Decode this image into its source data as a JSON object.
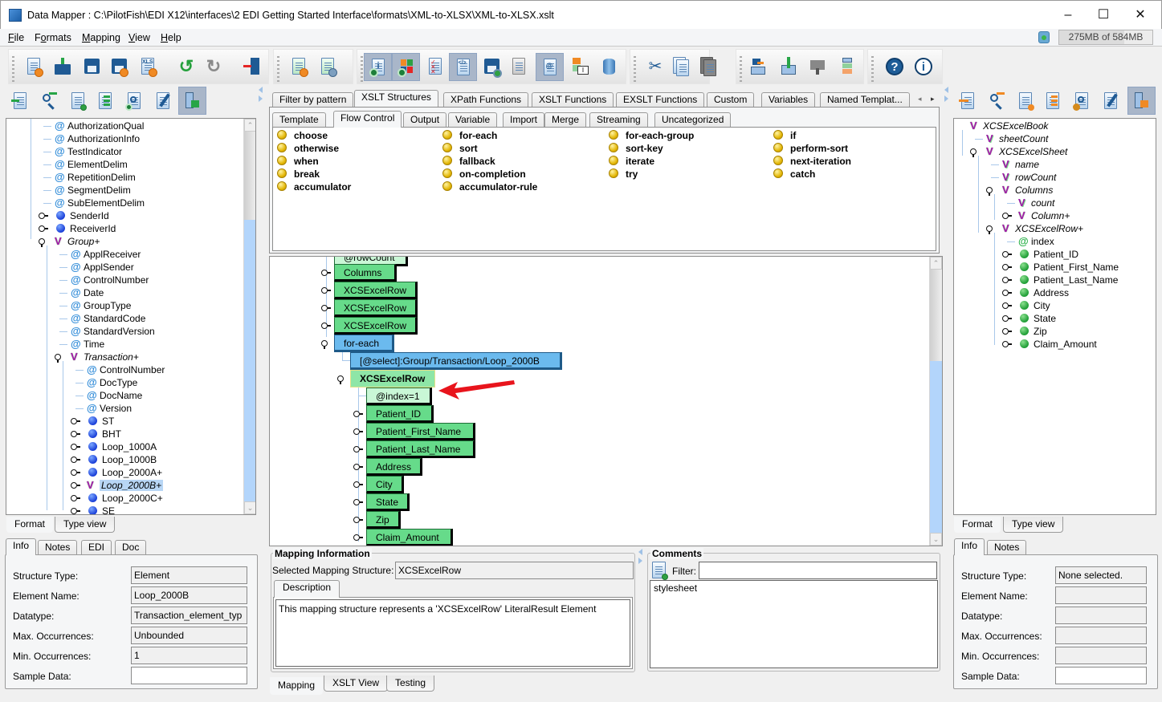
{
  "window": {
    "title": "Data Mapper : C:\\PilotFish\\EDI X12\\interfaces\\2 EDI Getting Started Interface\\formats\\XML-to-XLSX\\XML-to-XLSX.xslt",
    "minimize": "–",
    "maximize": "☐",
    "close": "✕"
  },
  "menu": [
    {
      "label": "File",
      "mnemonic": "F"
    },
    {
      "label": "Formats",
      "mnemonic": "o"
    },
    {
      "label": "Mapping",
      "mnemonic": "M"
    },
    {
      "label": "View",
      "mnemonic": "V"
    },
    {
      "label": "Help",
      "mnemonic": "H"
    }
  ],
  "memory": {
    "used": "275MB",
    "total": "584MB",
    "label": "275MB of 584MB",
    "fraction_used": 0.47
  },
  "main_toolbar": {
    "groups": [
      [
        "new-format",
        "open",
        "save",
        "save-as",
        "export-xls",
        "undo",
        "redo",
        "exit"
      ],
      [
        "new-mapping",
        "mapping-settings"
      ],
      [
        "show-info",
        "show-colors",
        "validate",
        "xslt-source",
        "save-schedule",
        "wsdl",
        "namespaces",
        "rename",
        "database"
      ],
      [
        "cut",
        "copy",
        "paste"
      ],
      [
        "move-up-level",
        "move-up",
        "move-down",
        "reorder"
      ],
      [
        "help",
        "about"
      ]
    ]
  },
  "source": {
    "toolbar": [
      "import",
      "find",
      "notes",
      "structure",
      "preview",
      "edit",
      "select-mode"
    ],
    "tree": [
      {
        "label": "AuthorizationQual",
        "type": "attribute",
        "depth": 1
      },
      {
        "label": "AuthorizationInfo",
        "type": "attribute",
        "depth": 1
      },
      {
        "label": "TestIndicator",
        "type": "attribute",
        "depth": 1
      },
      {
        "label": "ElementDelim",
        "type": "attribute",
        "depth": 1
      },
      {
        "label": "RepetitionDelim",
        "type": "attribute",
        "depth": 1
      },
      {
        "label": "SegmentDelim",
        "type": "attribute",
        "depth": 1
      },
      {
        "label": "SubElementDelim",
        "type": "attribute",
        "depth": 1
      },
      {
        "label": "SenderId",
        "type": "element",
        "depth": 1,
        "toggle": "collapsed"
      },
      {
        "label": "ReceiverId",
        "type": "element",
        "depth": 1,
        "toggle": "collapsed"
      },
      {
        "label": "Group+",
        "type": "group",
        "depth": 1,
        "toggle": "expanded"
      },
      {
        "label": "ApplReceiver",
        "type": "attribute",
        "depth": 2
      },
      {
        "label": "ApplSender",
        "type": "attribute",
        "depth": 2
      },
      {
        "label": "ControlNumber",
        "type": "attribute",
        "depth": 2
      },
      {
        "label": "Date",
        "type": "attribute",
        "depth": 2
      },
      {
        "label": "GroupType",
        "type": "attribute",
        "depth": 2
      },
      {
        "label": "StandardCode",
        "type": "attribute",
        "depth": 2
      },
      {
        "label": "StandardVersion",
        "type": "attribute",
        "depth": 2
      },
      {
        "label": "Time",
        "type": "attribute",
        "depth": 2
      },
      {
        "label": "Transaction+",
        "type": "group",
        "depth": 2,
        "toggle": "expanded"
      },
      {
        "label": "ControlNumber",
        "type": "attribute",
        "depth": 3
      },
      {
        "label": "DocType",
        "type": "attribute",
        "depth": 3
      },
      {
        "label": "DocName",
        "type": "attribute",
        "depth": 3
      },
      {
        "label": "Version",
        "type": "attribute",
        "depth": 3
      },
      {
        "label": "ST",
        "type": "element",
        "depth": 3,
        "toggle": "collapsed"
      },
      {
        "label": "BHT",
        "type": "element",
        "depth": 3,
        "toggle": "collapsed"
      },
      {
        "label": "Loop_1000A",
        "type": "element",
        "depth": 3,
        "toggle": "collapsed"
      },
      {
        "label": "Loop_1000B",
        "type": "element",
        "depth": 3,
        "toggle": "collapsed"
      },
      {
        "label": "Loop_2000A+",
        "type": "element",
        "depth": 3,
        "toggle": "collapsed"
      },
      {
        "label": "Loop_2000B+",
        "type": "group",
        "depth": 3,
        "toggle": "collapsed",
        "selected": true
      },
      {
        "label": "Loop_2000C+",
        "type": "element",
        "depth": 3,
        "toggle": "collapsed"
      },
      {
        "label": "SE",
        "type": "element",
        "depth": 3,
        "toggle": "collapsed"
      }
    ],
    "view_tabs": [
      "Format",
      "Type view"
    ],
    "active_view_tab": "Format",
    "info_tabs": [
      "Info",
      "Notes",
      "EDI",
      "Doc"
    ],
    "active_info_tab": "Info",
    "info": [
      {
        "label": "Structure Type:",
        "value": "Element"
      },
      {
        "label": "Element Name:",
        "value": "Loop_2000B"
      },
      {
        "label": "Datatype:",
        "value": "Transaction_element_typ"
      },
      {
        "label": "Max. Occurrences:",
        "value": "Unbounded"
      },
      {
        "label": "Min. Occurrences:",
        "value": "1"
      },
      {
        "label": "Sample Data:",
        "value": ""
      }
    ]
  },
  "palette": {
    "tabs": [
      "Filter by pattern",
      "XSLT Structures",
      "XPath Functions",
      "XSLT Functions",
      "EXSLT Functions",
      "Custom",
      "Variables",
      "Named Templat..."
    ],
    "active_tab": "XSLT Structures",
    "subtabs": [
      "Template",
      "Flow Control",
      "Output",
      "Variable",
      "Import",
      "Merge",
      "Streaming",
      "Uncategorized"
    ],
    "active_subtab": "Flow Control",
    "columns": [
      [
        "choose",
        "otherwise",
        "when",
        "break",
        "accumulator"
      ],
      [
        "for-each",
        "sort",
        "fallback",
        "on-completion",
        "accumulator-rule"
      ],
      [
        "for-each-group",
        "sort-key",
        "iterate",
        "try"
      ],
      [
        "if",
        "perform-sort",
        "next-iteration",
        "catch"
      ]
    ]
  },
  "mapping": {
    "nodes": [
      {
        "label": "@rowCount",
        "kind": "attr",
        "partial": true
      },
      {
        "label": "Columns",
        "kind": "element",
        "toggle": "collapsed"
      },
      {
        "label": "XCSExcelRow",
        "kind": "element",
        "toggle": "collapsed"
      },
      {
        "label": "XCSExcelRow",
        "kind": "element",
        "toggle": "collapsed"
      },
      {
        "label": "XCSExcelRow",
        "kind": "element",
        "toggle": "collapsed"
      },
      {
        "label": "for-each",
        "kind": "xslt",
        "toggle": "expanded"
      },
      {
        "label": "[@select]:Group/Transaction/Loop_2000B",
        "kind": "xslt-attr"
      },
      {
        "label": "XCSExcelRow",
        "kind": "selected",
        "toggle": "expanded"
      },
      {
        "label": "@index=1",
        "kind": "attr",
        "annotated": true
      },
      {
        "label": "Patient_ID",
        "kind": "element",
        "toggle": "collapsed"
      },
      {
        "label": "Patient_First_Name",
        "kind": "element",
        "toggle": "collapsed"
      },
      {
        "label": "Patient_Last_Name",
        "kind": "element",
        "toggle": "collapsed"
      },
      {
        "label": "Address",
        "kind": "element",
        "toggle": "collapsed"
      },
      {
        "label": "City",
        "kind": "element",
        "toggle": "collapsed"
      },
      {
        "label": "State",
        "kind": "element",
        "toggle": "collapsed"
      },
      {
        "label": "Zip",
        "kind": "element",
        "toggle": "collapsed"
      },
      {
        "label": "Claim_Amount",
        "kind": "element",
        "toggle": "collapsed"
      }
    ],
    "annotation_color": "#e8141c"
  },
  "mapping_info": {
    "legend": "Mapping Information",
    "selected_label": "Selected Mapping Structure:",
    "selected_value": "XCSExcelRow",
    "desc_tab": "Description",
    "description": "This mapping structure represents a 'XCSExcelRow' LiteralResult Element"
  },
  "comments": {
    "legend": "Comments",
    "filter_label": "Filter:",
    "filter_value": "",
    "items": [
      "stylesheet"
    ]
  },
  "bottom_tabs": [
    "Mapping",
    "XSLT View",
    "Testing"
  ],
  "active_bottom_tab": "Mapping",
  "target": {
    "toolbar": [
      "import",
      "find",
      "notes",
      "structure",
      "preview",
      "edit",
      "select-mode"
    ],
    "tree": [
      {
        "label": "XCSExcelBook",
        "type": "group",
        "depth": 0
      },
      {
        "label": "sheetCount",
        "type": "vattr",
        "depth": 1
      },
      {
        "label": "XCSExcelSheet",
        "type": "group",
        "depth": 1,
        "toggle": "expanded"
      },
      {
        "label": "name",
        "type": "vattr",
        "depth": 2
      },
      {
        "label": "rowCount",
        "type": "vattr",
        "depth": 2
      },
      {
        "label": "Columns",
        "type": "group",
        "depth": 2,
        "toggle": "expanded"
      },
      {
        "label": "count",
        "type": "vattr",
        "depth": 3
      },
      {
        "label": "Column+",
        "type": "group",
        "depth": 3,
        "toggle": "collapsed"
      },
      {
        "label": "XCSExcelRow+",
        "type": "group",
        "depth": 2,
        "toggle": "expanded"
      },
      {
        "label": "index",
        "type": "attribute",
        "depth": 3
      },
      {
        "label": "Patient_ID",
        "type": "element",
        "depth": 3,
        "toggle": "collapsed"
      },
      {
        "label": "Patient_First_Name",
        "type": "element",
        "depth": 3,
        "toggle": "collapsed"
      },
      {
        "label": "Patient_Last_Name",
        "type": "element",
        "depth": 3,
        "toggle": "collapsed"
      },
      {
        "label": "Address",
        "type": "element",
        "depth": 3,
        "toggle": "collapsed"
      },
      {
        "label": "City",
        "type": "element",
        "depth": 3,
        "toggle": "collapsed"
      },
      {
        "label": "State",
        "type": "element",
        "depth": 3,
        "toggle": "collapsed"
      },
      {
        "label": "Zip",
        "type": "element",
        "depth": 3,
        "toggle": "collapsed"
      },
      {
        "label": "Claim_Amount",
        "type": "element",
        "depth": 3,
        "toggle": "collapsed"
      }
    ],
    "view_tabs": [
      "Format",
      "Type view"
    ],
    "active_view_tab": "Format",
    "info_tabs": [
      "Info",
      "Notes"
    ],
    "active_info_tab": "Info",
    "info": [
      {
        "label": "Structure Type:",
        "value": "None selected."
      },
      {
        "label": "Element Name:",
        "value": ""
      },
      {
        "label": "Datatype:",
        "value": ""
      },
      {
        "label": "Max. Occurrences:",
        "value": ""
      },
      {
        "label": "Min. Occurrences:",
        "value": ""
      },
      {
        "label": "Sample Data:",
        "value": ""
      }
    ]
  }
}
